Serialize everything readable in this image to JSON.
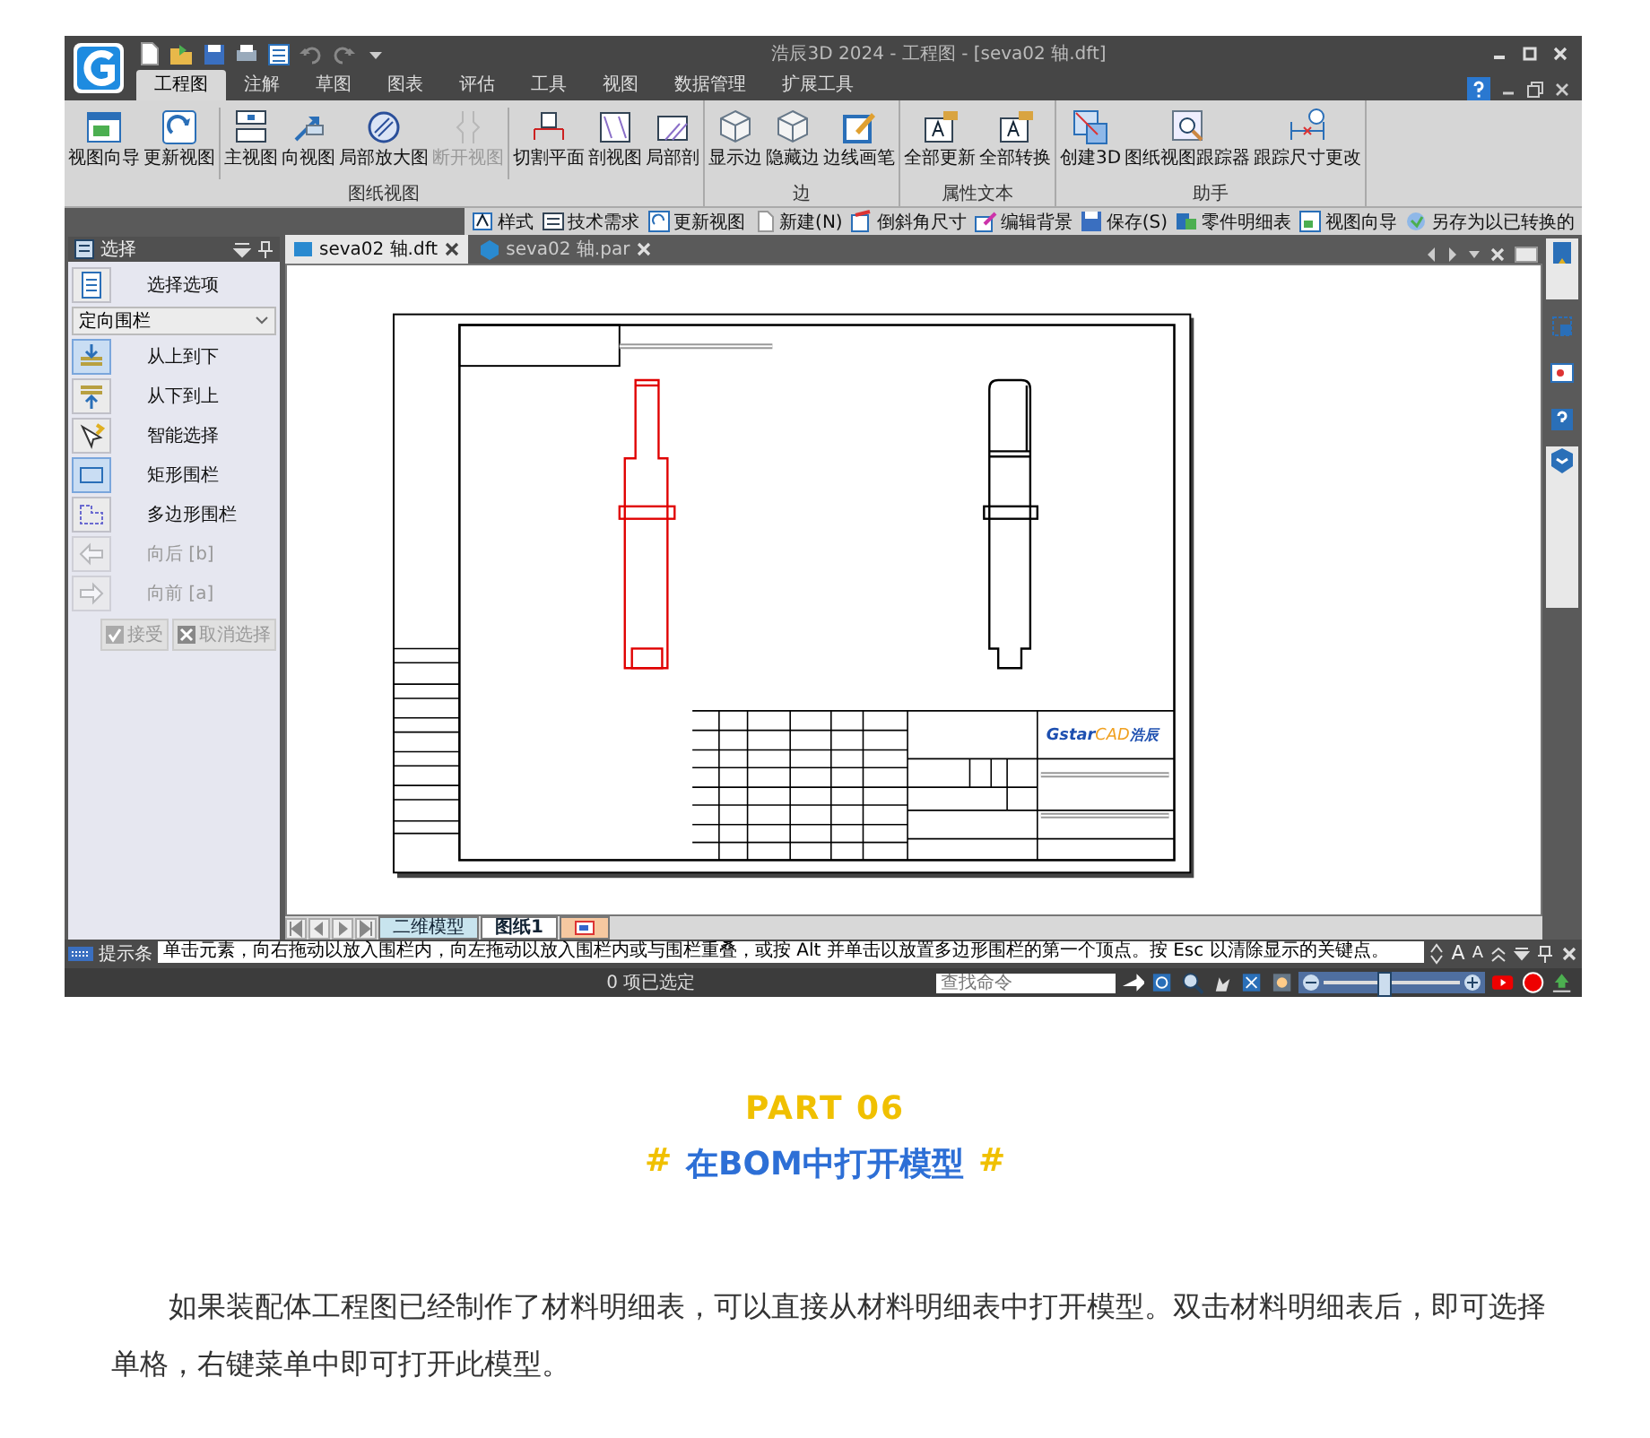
{
  "window": {
    "title": "浩辰3D 2024 - 工程图 - [seva02 轴.dft]"
  },
  "ribbon_tabs": [
    {
      "label": "工程图",
      "selected": true
    },
    {
      "label": "注解",
      "selected": false
    },
    {
      "label": "草图",
      "selected": false
    },
    {
      "label": "图表",
      "selected": false
    },
    {
      "label": "评估",
      "selected": false
    },
    {
      "label": "工具",
      "selected": false
    },
    {
      "label": "视图",
      "selected": false
    },
    {
      "label": "数据管理",
      "selected": false
    },
    {
      "label": "扩展工具",
      "selected": false
    }
  ],
  "ribbon_groups": [
    {
      "label": "图纸视图",
      "clusters": [
        [
          {
            "label": "视图向导",
            "disabled": false
          },
          {
            "label": "更新视图",
            "disabled": false
          }
        ],
        [
          {
            "label": "主视图",
            "disabled": false
          },
          {
            "label": "向视图",
            "disabled": false
          },
          {
            "label": "局部放大图",
            "disabled": false
          },
          {
            "label": "断开视图",
            "disabled": true
          }
        ],
        [
          {
            "label": "切割平面",
            "disabled": false
          },
          {
            "label": "剖视图",
            "disabled": false
          },
          {
            "label": "局部剖",
            "disabled": false
          }
        ]
      ]
    },
    {
      "label": "边",
      "clusters": [
        [
          {
            "label": "显示边",
            "disabled": false
          },
          {
            "label": "隐藏边",
            "disabled": false
          },
          {
            "label": "边线画笔",
            "disabled": false
          }
        ]
      ]
    },
    {
      "label": "属性文本",
      "clusters": [
        [
          {
            "label": "全部更新",
            "disabled": false
          },
          {
            "label": "全部转换",
            "disabled": false
          }
        ]
      ]
    },
    {
      "label": "助手",
      "clusters": [
        [
          {
            "label": "创建3D",
            "disabled": false
          },
          {
            "label": "图纸视图跟踪器",
            "disabled": false
          },
          {
            "label": "跟踪尺寸更改",
            "disabled": false
          }
        ]
      ]
    }
  ],
  "command_bar": [
    "样式",
    "技术需求",
    "更新视图",
    "新建(N)",
    "倒斜角尺寸",
    "编辑背景",
    "保存(S)",
    "零件明细表",
    "视图向导",
    "另存为以已转换的"
  ],
  "select_panel": {
    "title": "选择",
    "options_label": "选择选项",
    "dropdown": {
      "value": "定向围栏"
    },
    "items": [
      {
        "label": "从上到下",
        "selected": true,
        "disabled": false
      },
      {
        "label": "从下到上",
        "selected": false,
        "disabled": false
      },
      {
        "label": "智能选择",
        "selected": false,
        "disabled": false
      },
      {
        "label": "矩形围栏",
        "selected": true,
        "disabled": false
      },
      {
        "label": "多边形围栏",
        "selected": false,
        "disabled": false
      },
      {
        "label": "向后 [b]",
        "selected": false,
        "disabled": true
      },
      {
        "label": "向前 [a]",
        "selected": false,
        "disabled": true
      }
    ],
    "buttons": [
      {
        "label": "接受",
        "disabled": true
      },
      {
        "label": "取消选择",
        "disabled": true
      }
    ]
  },
  "document_tabs": [
    {
      "label": "seva02 轴.dft",
      "selected": true
    },
    {
      "label": "seva02 轴.par",
      "selected": false
    }
  ],
  "drawing": {
    "logo": [
      "Gstar",
      "CAD",
      "浩辰"
    ]
  },
  "sheet_tabs": [
    {
      "label": "二维模型",
      "selected": false
    },
    {
      "label": "图纸1",
      "selected": true
    }
  ],
  "prompt_bar": {
    "label": "提示条",
    "text": "单击元素，向右拖动以放入围栏内，向左拖动以放入围栏内或与围栏重叠，或按 Alt 并单击以放置多边形围栏的第一个顶点。按 Esc 以清除显示的关键点。",
    "font_buttons": [
      "A",
      "A"
    ]
  },
  "status_bar": {
    "selection": "0 项已选定",
    "search": {
      "placeholder": "查找命令"
    },
    "zoom": {
      "level": 0.45
    }
  },
  "article": {
    "part": "PART 06",
    "heading": {
      "prefix": "#",
      "text": "在BOM中打开模型",
      "suffix": "#"
    },
    "body": "如果装配体工程图已经制作了材料明细表，可以直接从材料明细表中打开模型。双击材料明细表后，即可选择单格，右键菜单中即可打开此模型。"
  }
}
